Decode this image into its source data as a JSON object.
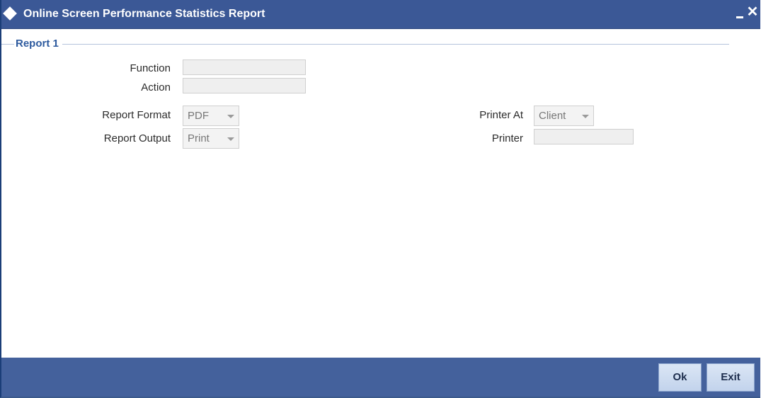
{
  "window": {
    "title": "Online Screen Performance Statistics Report",
    "minimize_icon": "minimize-icon",
    "close_icon": "close-icon",
    "close_glyph": "✕"
  },
  "section": {
    "title": "Report 1"
  },
  "fields": {
    "function_label": "Function",
    "function_value": "",
    "action_label": "Action",
    "action_value": "",
    "report_format_label": "Report Format",
    "report_format_value": "PDF",
    "report_output_label": "Report Output",
    "report_output_value": "Print",
    "printer_at_label": "Printer At",
    "printer_at_value": "Client",
    "printer_label": "Printer",
    "printer_value": ""
  },
  "footer": {
    "ok_label": "Ok",
    "exit_label": "Exit"
  },
  "colors": {
    "titlebar": "#3b5896",
    "footer": "#44619c",
    "section_title": "#2d5a9e"
  }
}
